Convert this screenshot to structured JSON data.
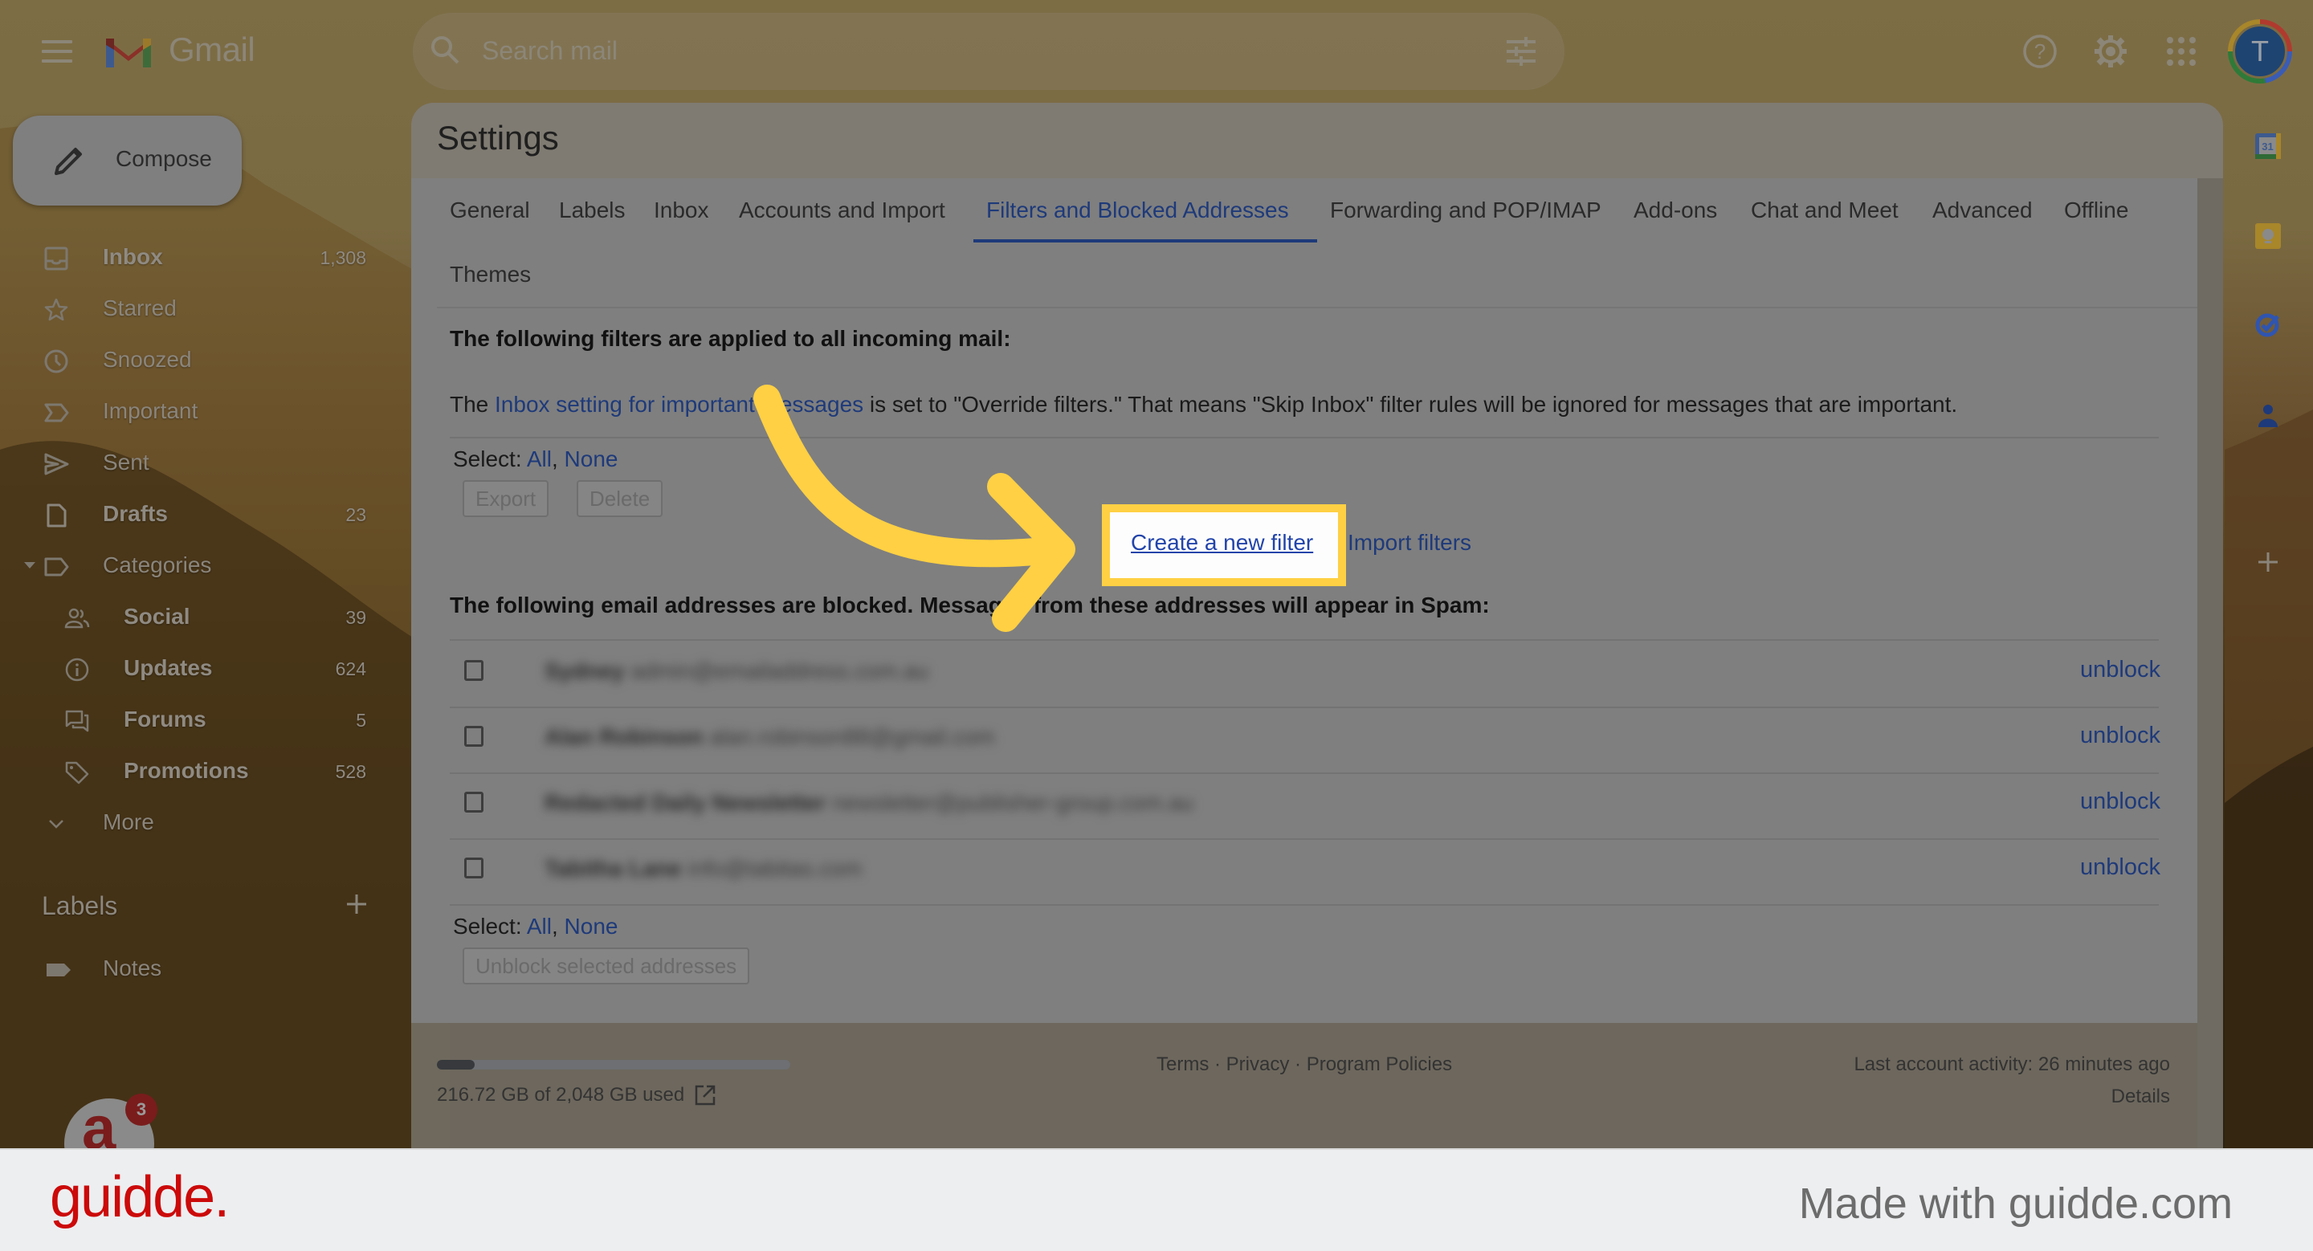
{
  "app": {
    "name": "Gmail",
    "search_placeholder": "Search mail",
    "avatar_initial": "T",
    "icons": [
      "menu-icon",
      "gmail-logo",
      "search-icon",
      "tune-icon",
      "help-icon",
      "settings-icon",
      "apps-icon"
    ]
  },
  "sidebar": {
    "compose_label": "Compose",
    "items": [
      {
        "label": "Inbox",
        "count": "1,308",
        "icon": "inbox-icon",
        "bold": true
      },
      {
        "label": "Starred",
        "count": "",
        "icon": "star-icon",
        "bold": false
      },
      {
        "label": "Snoozed",
        "count": "",
        "icon": "clock-icon",
        "bold": false
      },
      {
        "label": "Important",
        "count": "",
        "icon": "important-icon",
        "bold": false
      },
      {
        "label": "Sent",
        "count": "",
        "icon": "send-icon",
        "bold": false
      },
      {
        "label": "Drafts",
        "count": "23",
        "icon": "draft-icon",
        "bold": true
      },
      {
        "label": "Categories",
        "count": "",
        "icon": "label-icon",
        "bold": false
      },
      {
        "label": "Social",
        "count": "39",
        "icon": "people-icon",
        "bold": true
      },
      {
        "label": "Updates",
        "count": "624",
        "icon": "info-icon",
        "bold": true
      },
      {
        "label": "Forums",
        "count": "5",
        "icon": "forum-icon",
        "bold": true
      },
      {
        "label": "Promotions",
        "count": "528",
        "icon": "tag-icon",
        "bold": true
      },
      {
        "label": "More",
        "count": "",
        "icon": "chevron-down-icon",
        "bold": false
      }
    ],
    "labels_heading": "Labels",
    "labels": [
      {
        "label": "Notes"
      }
    ],
    "widget_badge": "3"
  },
  "settings": {
    "title": "Settings",
    "tabs": [
      {
        "label": "General",
        "active": false
      },
      {
        "label": "Labels",
        "active": false
      },
      {
        "label": "Inbox",
        "active": false
      },
      {
        "label": "Accounts and Import",
        "active": false
      },
      {
        "label": "Filters and Blocked Addresses",
        "active": true
      },
      {
        "label": "Forwarding and POP/IMAP",
        "active": false
      },
      {
        "label": "Add-ons",
        "active": false
      },
      {
        "label": "Chat and Meet",
        "active": false
      },
      {
        "label": "Advanced",
        "active": false
      },
      {
        "label": "Offline",
        "active": false
      },
      {
        "label": "Themes",
        "active": false
      }
    ],
    "filters": {
      "heading": "The following filters are applied to all incoming mail:",
      "note_prefix": "The ",
      "note_link": "Inbox setting for important messages",
      "note_suffix": " is set to \"Override filters.\" That means \"Skip Inbox\" filter rules will be ignored for messages that are important.",
      "select_label": "Select: ",
      "select_all": "All",
      "select_sep": ", ",
      "select_none": "None",
      "export_label": "Export",
      "delete_label": "Delete",
      "create_filter": "Create a new filter",
      "import_filters": "Import filters"
    },
    "blocked": {
      "heading": "The following email addresses are blocked. Messages from these addresses will appear in Spam:",
      "rows": [
        {
          "name": "Sydney",
          "email": "admin@emailaddress.com.au",
          "action": "unblock"
        },
        {
          "name": "Alan Robinson",
          "email": "alan.robinson88@gmail.com",
          "action": "unblock"
        },
        {
          "name": "Redacted Daily Newsletter",
          "email": "newsletter@publisher-group.com.au",
          "action": "unblock"
        },
        {
          "name": "Tabitha Lane",
          "email": "info@tabitas.com",
          "action": "unblock"
        }
      ],
      "select_label": "Select: ",
      "select_all": "All",
      "select_sep": ", ",
      "select_none": "None",
      "unblock_selected": "Unblock selected addresses"
    }
  },
  "footer": {
    "storage_text": "216.72 GB of 2,048 GB used",
    "storage_used_fraction": 0.106,
    "terms": "Terms",
    "privacy": "Privacy",
    "policies": "Program Policies",
    "sep": " · ",
    "activity": "Last account activity: 26 minutes ago",
    "details": "Details"
  },
  "side_apps": [
    "calendar-icon",
    "keep-icon",
    "tasks-icon",
    "contacts-icon",
    "add-app-icon"
  ],
  "calendar_day": "31",
  "guidde": {
    "logo": "guidde.",
    "made_with": "Made with guidde.com"
  },
  "colors": {
    "accent_link": "#1e3a7a",
    "highlight": "#ffd043",
    "guidde_red": "#cc0a0a"
  }
}
